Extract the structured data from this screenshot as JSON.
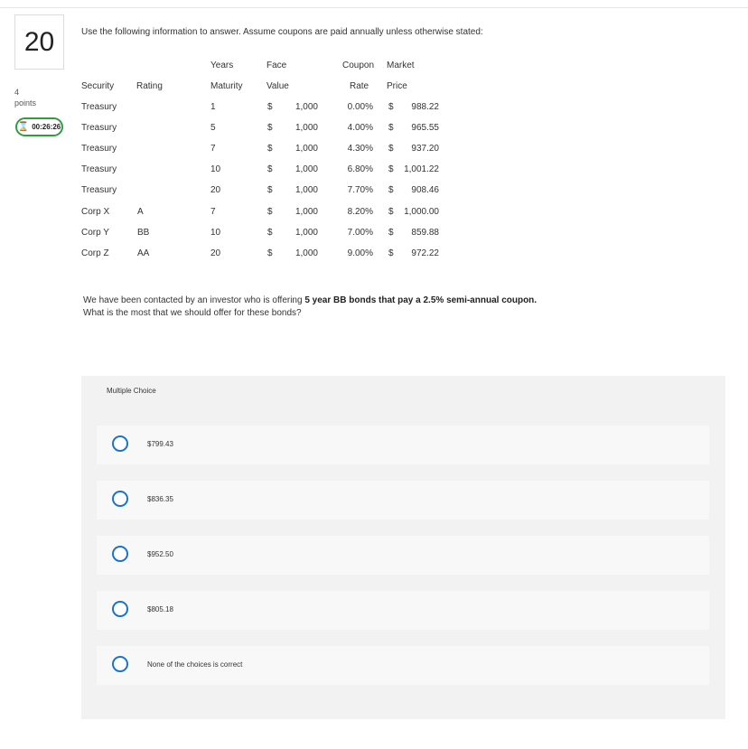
{
  "question": {
    "number": "20",
    "points_value": "4",
    "points_label": "points",
    "timer": "00:26:26",
    "timer_icon": "hourglass-icon",
    "instruction": "Use the following information to answer.  Assume coupons are paid annually unless otherwise stated:",
    "prompt_pre": "We have been contacted by an investor who is offering ",
    "prompt_bold": "5 year BB bonds that pay a 2.5% semi-annual coupon.",
    "prompt_post": "What is the most that we should offer for these bonds?"
  },
  "table": {
    "headers_top": {
      "years": "Years",
      "face": "Face",
      "coupon": "Coupon",
      "market": "Market"
    },
    "headers": {
      "security": "Security",
      "rating": "Rating",
      "maturity": "Maturity",
      "value": "Value",
      "rate": "Rate",
      "price": "Price"
    },
    "rows": [
      {
        "security": "Treasury",
        "rating": "",
        "years": "1",
        "face_sym": "$",
        "face": "1,000",
        "coupon": "0.00%",
        "price_sym": "$",
        "price": "988.22"
      },
      {
        "security": "Treasury",
        "rating": "",
        "years": "5",
        "face_sym": "$",
        "face": "1,000",
        "coupon": "4.00%",
        "price_sym": "$",
        "price": "965.55"
      },
      {
        "security": "Treasury",
        "rating": "",
        "years": "7",
        "face_sym": "$",
        "face": "1,000",
        "coupon": "4.30%",
        "price_sym": "$",
        "price": "937.20"
      },
      {
        "security": "Treasury",
        "rating": "",
        "years": "10",
        "face_sym": "$",
        "face": "1,000",
        "coupon": "6.80%",
        "price_sym": "$",
        "price": "1,001.22"
      },
      {
        "security": "Treasury",
        "rating": "",
        "years": "20",
        "face_sym": "$",
        "face": "1,000",
        "coupon": "7.70%",
        "price_sym": "$",
        "price": "908.46"
      },
      {
        "security": "Corp X",
        "rating": "A",
        "years": "7",
        "face_sym": "$",
        "face": "1,000",
        "coupon": "8.20%",
        "price_sym": "$",
        "price": "1,000.00"
      },
      {
        "security": "Corp Y",
        "rating": "BB",
        "years": "10",
        "face_sym": "$",
        "face": "1,000",
        "coupon": "7.00%",
        "price_sym": "$",
        "price": "859.88"
      },
      {
        "security": "Corp Z",
        "rating": "AA",
        "years": "20",
        "face_sym": "$",
        "face": "1,000",
        "coupon": "9.00%",
        "price_sym": "$",
        "price": "972.22"
      }
    ]
  },
  "multiple_choice": {
    "header": "Multiple Choice",
    "options": [
      {
        "label": "$799.43"
      },
      {
        "label": "$836.35"
      },
      {
        "label": "$952.50"
      },
      {
        "label": "$805.18"
      },
      {
        "label": "None of the choices is correct"
      }
    ]
  },
  "colors": {
    "radio_border": "#1a73c8",
    "timer_border": "#2e9e3e",
    "panel_bg": "#f2f2f2"
  }
}
